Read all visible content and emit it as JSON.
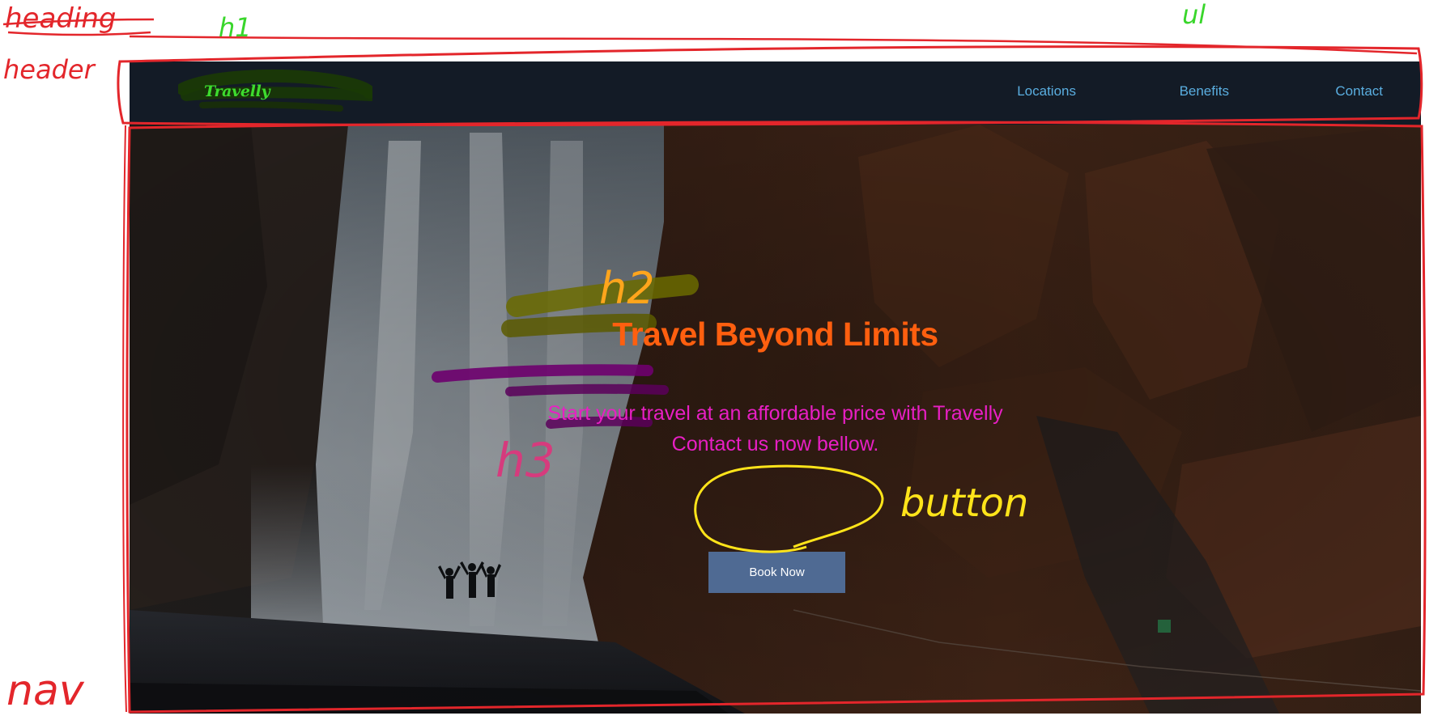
{
  "site": {
    "brand": "Travelly",
    "nav": [
      {
        "label": "Locations"
      },
      {
        "label": "Benefits"
      },
      {
        "label": "Contact"
      }
    ],
    "hero": {
      "title": "Travel Beyond Limits",
      "subtitle_line1": "Start your travel at an affordable price with Travelly",
      "subtitle_line2": "Contact us now bellow.",
      "button_label": "Book Now"
    }
  },
  "annotations": {
    "heading_struck": "heading",
    "header": "header",
    "h1": "h1",
    "ul": "ul",
    "h2": "h2",
    "h3": "h3",
    "button": "button",
    "nav": "nav"
  },
  "colors": {
    "nav_bg": "#131b26",
    "brand": "#3ddc2e",
    "nav_link": "#5aaee0",
    "title": "#ff5f0f",
    "subtitle": "#e81fc4",
    "button_bg": "#4f6a93",
    "marker_red": "#e3262b",
    "marker_green": "#39d62b",
    "marker_yellow": "#ffe41a",
    "marker_orange": "#ffa51c",
    "marker_pink": "#d63b7d"
  }
}
